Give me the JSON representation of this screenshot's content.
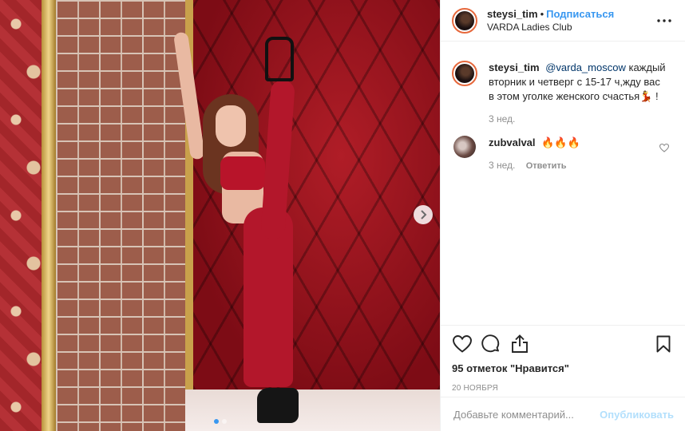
{
  "post": {
    "author": {
      "username": "steysi_tim",
      "separator": "•",
      "follow_label": "Подписаться",
      "location": "VARDA Ladies Club"
    },
    "caption": {
      "username": "steysi_tim",
      "mention": "@varda_moscow",
      "text": "каждый вторник и четверг с 15-17 ч,жду вас в этом уголке женского счастья💃 !",
      "time": "3 нед."
    },
    "comments": [
      {
        "username": "zubvalval",
        "text": "🔥🔥🔥",
        "time": "3 нед.",
        "reply_label": "Ответить"
      }
    ],
    "likes_text": "95 отметок \"Нравится\"",
    "date": "20 НОЯБРЯ",
    "comment_input": {
      "placeholder": "Добавьте комментарий...",
      "publish_label": "Опубликовать"
    },
    "carousel": {
      "slide_count": 2,
      "active_index": 0
    }
  },
  "colors": {
    "accent": "#3897f0",
    "publish_disabled": "#b2dffc",
    "muted_text": "#8e8e8e",
    "mention": "#003569"
  },
  "icons": [
    "more-icon",
    "heart-icon",
    "comment-icon",
    "share-icon",
    "bookmark-icon",
    "chevron-right-icon",
    "small-heart-icon"
  ]
}
